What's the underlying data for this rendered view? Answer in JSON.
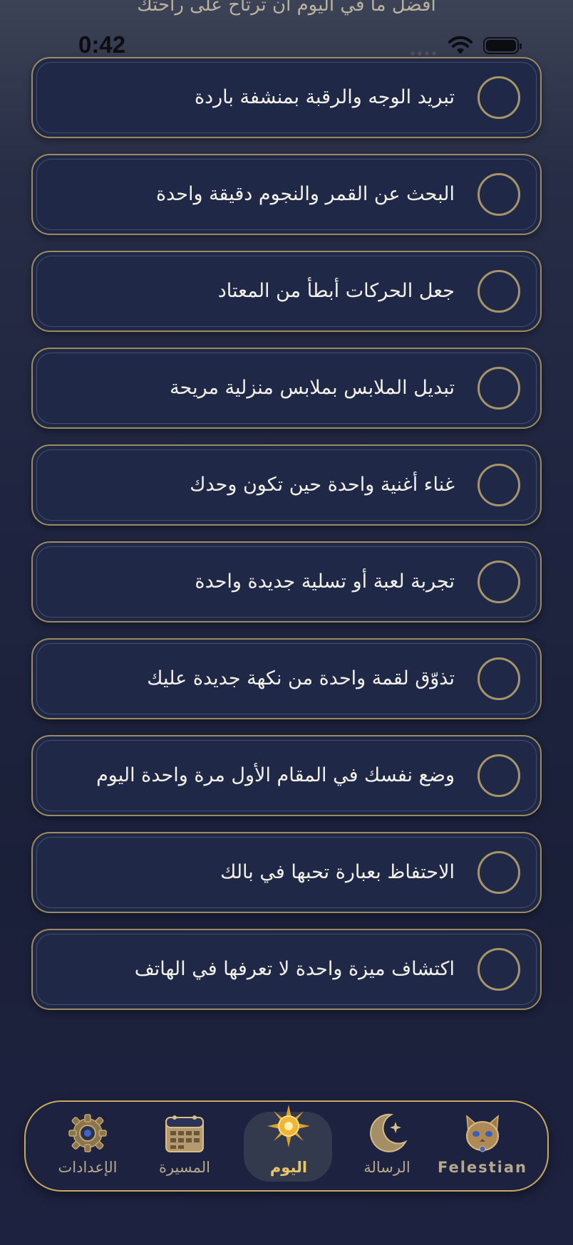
{
  "header": {
    "subtitle": "افضل ما في اليوم ان ترتاح على راحتك"
  },
  "status_bar": {
    "time": "0:42"
  },
  "tasks": [
    {
      "label": "تبريد الوجه والرقبة بمنشفة باردة"
    },
    {
      "label": "البحث عن القمر والنجوم دقيقة واحدة"
    },
    {
      "label": "جعل الحركات أبطأ من المعتاد"
    },
    {
      "label": "تبديل الملابس بملابس منزلية مريحة"
    },
    {
      "label": "غناء أغنية واحدة حين تكون وحدك"
    },
    {
      "label": "تجربة لعبة أو تسلية جديدة واحدة"
    },
    {
      "label": "تذوّق لقمة واحدة من نكهة جديدة عليك"
    },
    {
      "label": "وضع نفسك في المقام الأول مرة واحدة اليوم"
    },
    {
      "label": "الاحتفاظ بعبارة تحبها في بالك"
    },
    {
      "label": "اكتشاف ميزة واحدة لا تعرفها في الهاتف"
    }
  ],
  "tabbar": {
    "tabs": [
      {
        "label": "الإعدادات",
        "icon": "gear-icon",
        "active": false
      },
      {
        "label": "المسيرة",
        "icon": "calendar-icon",
        "active": false
      },
      {
        "label": "اليوم",
        "icon": "sun-icon",
        "active": true
      },
      {
        "label": "الرسالة",
        "icon": "moon-star-icon",
        "active": false
      },
      {
        "label": "Felestian",
        "icon": "cat-icon",
        "active": false
      }
    ]
  },
  "colors": {
    "accent_gold": "#c9a95e",
    "card_bg": "#1f2846",
    "active_label": "#e9c46a"
  }
}
